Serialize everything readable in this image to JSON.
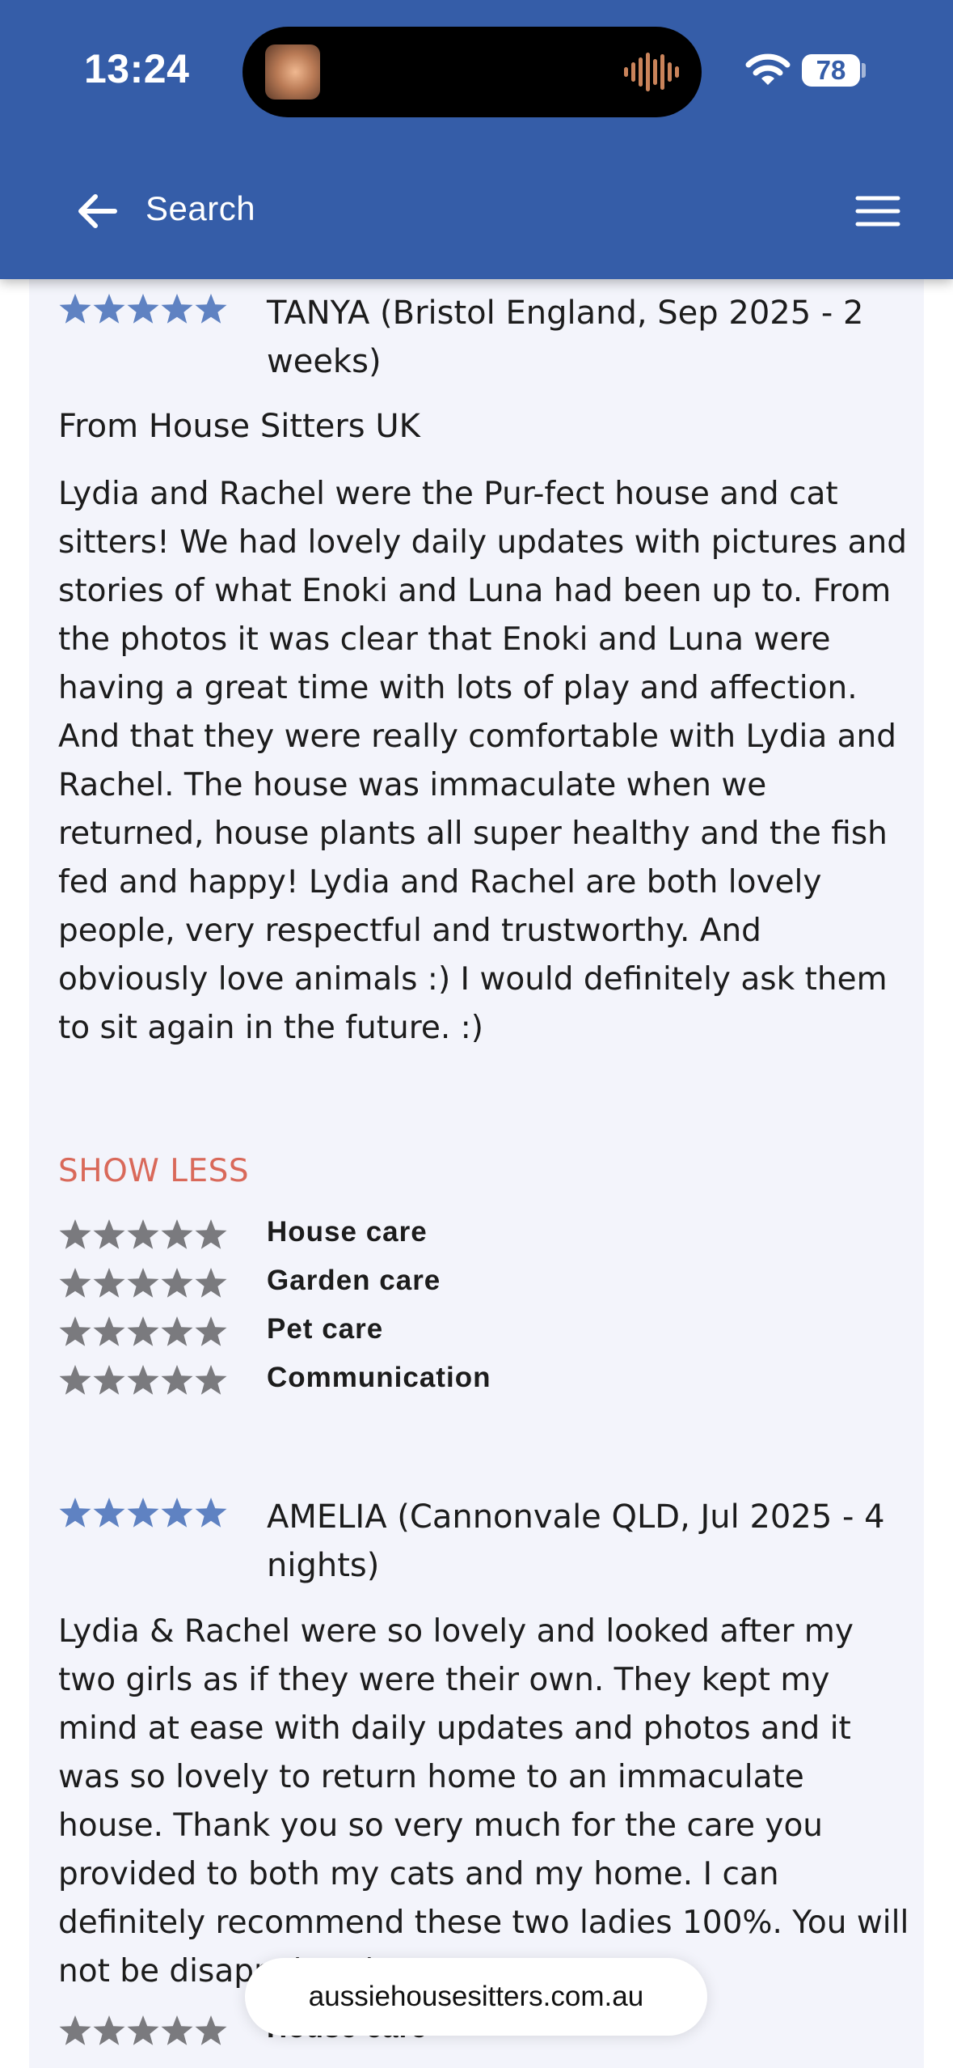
{
  "status": {
    "time": "13:24",
    "battery": "78"
  },
  "header": {
    "title": "Search",
    "back_icon": "arrow-left-icon",
    "menu_icon": "hamburger-menu-icon"
  },
  "colors": {
    "brand": "#355da8",
    "star_blue": "#5f82c2",
    "star_gray": "#7a7a7e",
    "accent": "#d9695a",
    "card_bg": "#f3f4fb"
  },
  "reviews": [
    {
      "reviewer": "TANYA (Bristol England, Sep 2025 - 2 weeks)",
      "source": "From House Sitters UK",
      "body": "Lydia and Rachel were the Pur-fect house and cat sitters! We had lovely daily updates with pictures and stories of what Enoki and Luna had been up to. From the photos it was clear that Enoki and Luna were having a great time with lots of play and affection. And that they were really comfortable with Lydia and Rachel. The house was immaculate when we returned, house plants all super healthy and the fish fed and happy! Lydia and Rachel are both lovely people, very respectful and trustworthy. And obviously love animals :) I would definitely ask them to sit again in the future. :)",
      "stars": 5,
      "toggle_label": "SHOW LESS",
      "ratings": [
        {
          "label": "House care",
          "stars": 5
        },
        {
          "label": "Garden care",
          "stars": 5
        },
        {
          "label": "Pet care",
          "stars": 5
        },
        {
          "label": "Communication",
          "stars": 5
        }
      ]
    },
    {
      "reviewer": "AMELIA (Cannonvale QLD, Jul 2025 - 4 nights)",
      "body": "Lydia & Rachel were so lovely and looked after my two girls as if they were their own. They kept my mind at ease with daily updates and photos and it was so lovely to return home to an immaculate house. Thank you so very much for the care you provided to both my cats and my home. I can definitely recommend these two ladies 100%. You will not be disappointed.",
      "stars": 5,
      "ratings": [
        {
          "label": "House care",
          "stars": 5
        }
      ]
    }
  ],
  "url": "aussiehousesitters.com.au"
}
